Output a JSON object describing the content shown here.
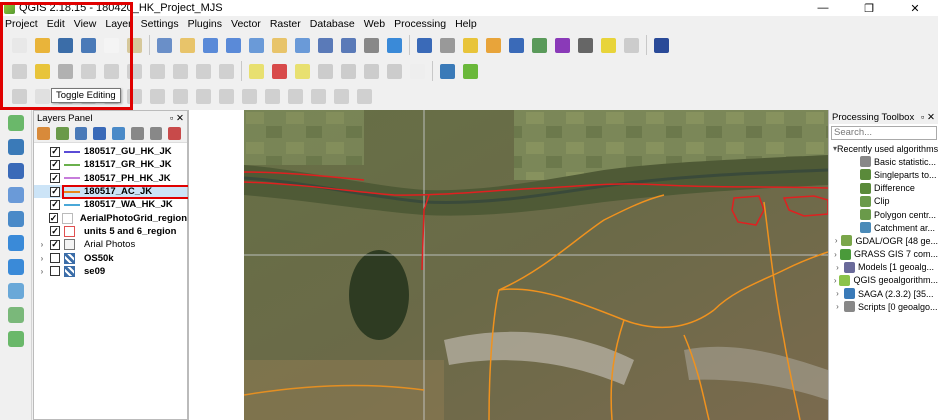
{
  "window": {
    "title": "QGIS 2.18.15 - 180420_HK_Project_MJS",
    "minimize": "—",
    "maximize": "❐",
    "close": "✕"
  },
  "menu": [
    "Project",
    "Edit",
    "View",
    "Layer",
    "Settings",
    "Plugins",
    "Vector",
    "Raster",
    "Database",
    "Web",
    "Processing",
    "Help"
  ],
  "tooltip": "Toggle Editing",
  "layers_panel": {
    "title": "Layers Panel",
    "layers": [
      {
        "name": "180517_GU_HK_JK",
        "checked": true,
        "symbol": "line",
        "color": "#5a4bd6",
        "expandable": false
      },
      {
        "name": "181517_GR_HK_JK",
        "checked": true,
        "symbol": "line",
        "color": "#6ab04c",
        "expandable": false
      },
      {
        "name": "180517_PH_HK_JK",
        "checked": true,
        "symbol": "line",
        "color": "#c77ddb",
        "expandable": false
      },
      {
        "name": "180517_AC_JK",
        "checked": true,
        "symbol": "line",
        "color": "#e8861a",
        "expandable": false
      },
      {
        "name": "180517_WA_HK_JK",
        "checked": true,
        "symbol": "line",
        "color": "#4aa8d8",
        "expandable": false
      },
      {
        "name": "AerialPhotoGrid_region",
        "checked": true,
        "symbol": "poly",
        "color": "#bbbbbb",
        "expandable": false
      },
      {
        "name": "units 5 and 6_region",
        "checked": true,
        "symbol": "poly",
        "color": "#e05050",
        "expandable": false
      },
      {
        "name": "Arial Photos",
        "checked": true,
        "symbol": "group",
        "color": "#888888",
        "expandable": true
      },
      {
        "name": "OS50k",
        "checked": false,
        "symbol": "raster",
        "color": "#3b6da8",
        "expandable": true
      },
      {
        "name": "se09",
        "checked": false,
        "symbol": "raster",
        "color": "#3b6da8",
        "expandable": true
      }
    ]
  },
  "processing_toolbox": {
    "title": "Processing Toolbox",
    "search_placeholder": "Search...",
    "items": [
      {
        "label": "Recently used algorithms",
        "indent": 0,
        "expander": "▾",
        "icon": "none",
        "color": ""
      },
      {
        "label": "Basic statistic...",
        "indent": 2,
        "expander": "",
        "icon": "table",
        "color": "#888"
      },
      {
        "label": "Singleparts to...",
        "indent": 2,
        "expander": "",
        "icon": "vector",
        "color": "#5a8a3a"
      },
      {
        "label": "Difference",
        "indent": 2,
        "expander": "",
        "icon": "vector",
        "color": "#5a8a3a"
      },
      {
        "label": "Clip",
        "indent": 2,
        "expander": "",
        "icon": "vector",
        "color": "#6a9a4a"
      },
      {
        "label": "Polygon centr...",
        "indent": 2,
        "expander": "",
        "icon": "vector",
        "color": "#6a9a4a"
      },
      {
        "label": "Catchment ar...",
        "indent": 2,
        "expander": "",
        "icon": "saga",
        "color": "#4a8ab8"
      },
      {
        "label": "GDAL/OGR [48 ge...",
        "indent": 0,
        "expander": "›",
        "icon": "gdal",
        "color": "#7aa64a"
      },
      {
        "label": "GRASS GIS 7 com...",
        "indent": 0,
        "expander": "›",
        "icon": "grass",
        "color": "#4a9a3a"
      },
      {
        "label": "Models [1 geoalg...",
        "indent": 0,
        "expander": "›",
        "icon": "model",
        "color": "#6a6a9a"
      },
      {
        "label": "QGIS geoalgorithm...",
        "indent": 0,
        "expander": "›",
        "icon": "qgis",
        "color": "#8bc34a"
      },
      {
        "label": "SAGA (2.3.2) [35...",
        "indent": 0,
        "expander": "›",
        "icon": "saga",
        "color": "#3a7ab8"
      },
      {
        "label": "Scripts [0 geoalgo...",
        "indent": 0,
        "expander": "›",
        "icon": "script",
        "color": "#888"
      }
    ]
  },
  "colors": {
    "highlight": "#e00000",
    "selection": "#cce4f7",
    "orange_line": "#f0921e",
    "red_line": "#e02020"
  }
}
